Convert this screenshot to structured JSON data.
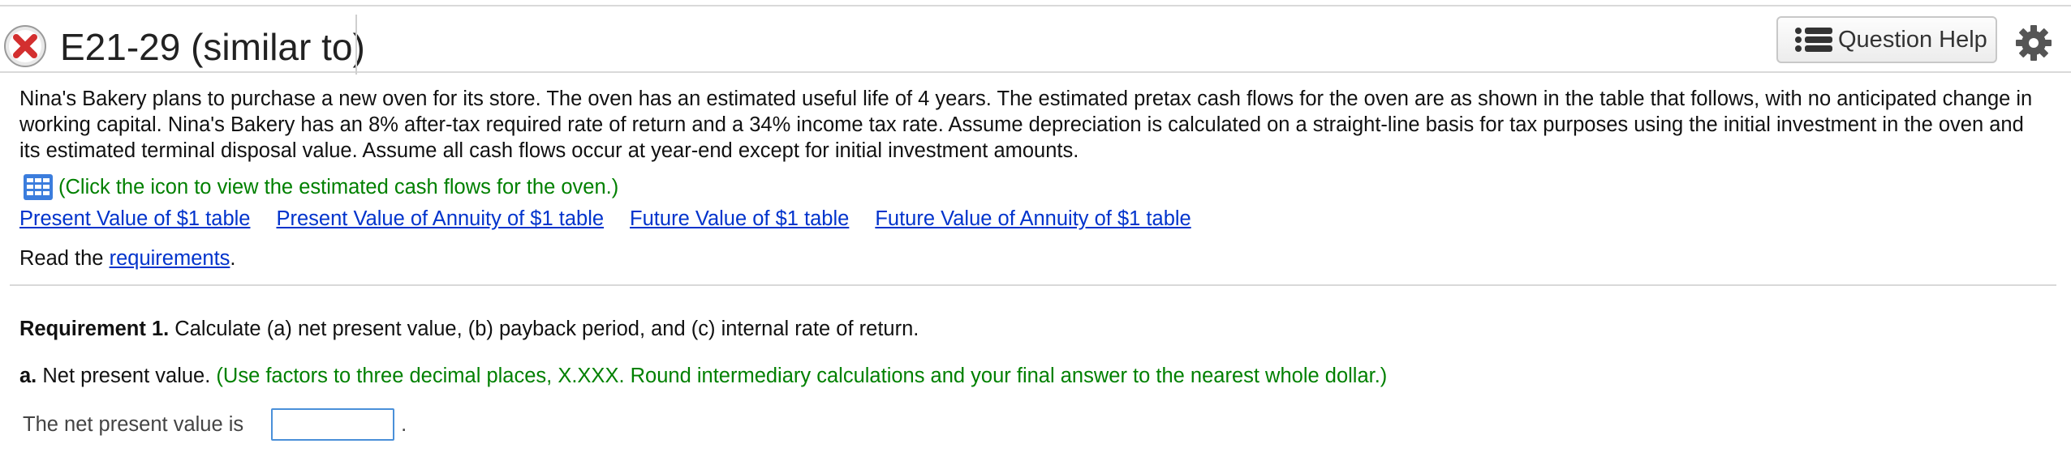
{
  "header": {
    "title": "E21-29 (similar to)",
    "question_help_label": "Question Help",
    "icons": {
      "status": "incorrect-x-icon",
      "help": "list-icon",
      "settings": "gear-icon"
    }
  },
  "problem": {
    "text": "Nina's Bakery plans to purchase a new oven for its store. The oven has an estimated useful life of 4 years. The estimated pretax cash flows for the oven are as shown in the table that follows, with no anticipated change in working capital. Nina's Bakery has an 8% after-tax required rate of return and a 34% income tax rate. Assume depreciation is calculated on a straight-line basis for tax purposes using the initial investment in the oven and its estimated terminal disposal value. Assume all cash flows occur at year-end except for initial investment amounts.",
    "cash_flows_link": "(Click the icon to view the estimated cash flows for the oven.)"
  },
  "links": [
    {
      "label": "Present Value of $1 table"
    },
    {
      "label": "Present Value of Annuity of $1 table"
    },
    {
      "label": "Future Value of $1 table"
    },
    {
      "label": "Future Value of Annuity of $1 table"
    }
  ],
  "read": {
    "prefix": "Read the ",
    "link": "requirements",
    "suffix": "."
  },
  "requirement": {
    "label": "Requirement 1.",
    "text": " Calculate (a) net present value, (b) payback period, and (c) internal rate of return."
  },
  "part_a": {
    "label": "a.",
    "text": " Net present value. ",
    "instruction": "(Use factors to three decimal places, X.XXX. Round intermediary calculations and your final answer to the nearest whole dollar.)"
  },
  "answer": {
    "label": "The net present value is",
    "value": "",
    "suffix": "."
  },
  "colors": {
    "link": "#0033cc",
    "instruction": "#008000",
    "input_border": "#4a90d9",
    "error_icon": "#d32f2f"
  }
}
